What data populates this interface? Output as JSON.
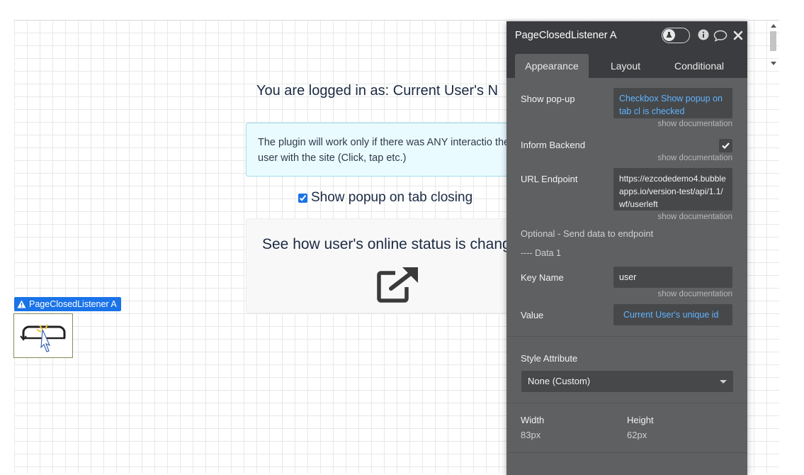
{
  "canvas": {
    "logged_in_text": "You are logged in as: Current User's N",
    "info_text": "The plugin will work only if there was ANY interactio the user with the site (Click, tap etc.)",
    "checkbox_label": "Show popup on tab closing",
    "checkbox_checked": true,
    "status_title": "See how user's online status is chang",
    "external_icon": "external-link-icon",
    "element_label": "PageClosedListener A",
    "element_warning_icon": "warning-icon"
  },
  "panel": {
    "title": "PageClosedListener A",
    "header_icons": [
      "inspector-toggle",
      "info-icon",
      "comment-icon",
      "close-icon"
    ],
    "tabs": [
      {
        "label": "Appearance",
        "active": true
      },
      {
        "label": "Layout",
        "active": false
      },
      {
        "label": "Conditional",
        "active": false
      }
    ],
    "show_popup": {
      "label": "Show pop-up",
      "value": "Checkbox Show popup on tab cl is checked"
    },
    "show_documentation": "show documentation",
    "inform_backend": {
      "label": "Inform Backend",
      "checked": true
    },
    "url_endpoint": {
      "label": "URL Endpoint",
      "value": "https://ezcodedemo4.bubbleapps.io/version-test/api/1.1/wf/userleft"
    },
    "optional_text": "Optional - Send data to endpoint",
    "data_header": "---- Data 1",
    "key_name": {
      "label": "Key Name",
      "value": "user"
    },
    "value": {
      "label": "Value",
      "value": "Current User's unique id"
    },
    "style_attribute": {
      "label": "Style Attribute",
      "value": "None (Custom)"
    },
    "width": {
      "label": "Width",
      "value": "83px"
    },
    "height": {
      "label": "Height",
      "value": "62px"
    }
  },
  "colors": {
    "panel_bg": "#5e6062",
    "panel_header": "#3b3c3f",
    "accent_blue": "#1a73e8",
    "dynamic_text": "#62b3ff"
  }
}
